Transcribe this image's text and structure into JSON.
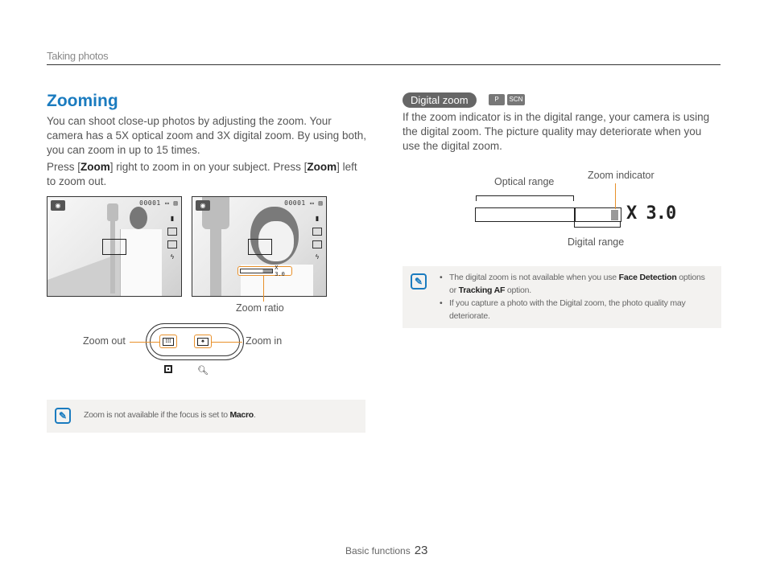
{
  "header": {
    "section": "Taking photos"
  },
  "left": {
    "title": "Zooming",
    "intro": "You can shoot close-up photos by adjusting the zoom. Your camera has a 5X optical zoom and 3X digital zoom. By using both, you can zoom in up to 15 times.",
    "press": {
      "pre": "Press [",
      "key1": "Zoom",
      "mid": "] right to zoom in on your subject. Press [",
      "key2": "Zoom",
      "post": "] left to zoom out."
    },
    "screen": {
      "mode_icon": "camera-program-icon",
      "status": "00001 ▭ ▥",
      "side_icons": [
        "image-size-icon",
        "quality-icon",
        "metering-icon",
        "flash-auto-icon"
      ],
      "zoom_bar_text": "X 3.0"
    },
    "zoom_ratio_label": "Zoom ratio",
    "lever": {
      "zoom_out_label": "Zoom out",
      "zoom_in_label": "Zoom in",
      "out_icon": "wide-icon",
      "in_icon": "tele-icon"
    },
    "note": {
      "icon": "note-pencil-icon",
      "text_pre": "Zoom is not available if the focus is set to ",
      "bold": "Macro",
      "text_post": "."
    }
  },
  "right": {
    "badge": "Digital zoom",
    "mode_icons": [
      "program-mode-icon",
      "scene-mode-icon"
    ],
    "mode_icon_text": [
      "P",
      "SCN"
    ],
    "para": "If the zoom indicator is in the digital range, your camera is using the digital zoom. The picture quality may deteriorate when you use the digital zoom.",
    "diagram": {
      "optical_label": "Optical range",
      "indicator_label": "Zoom indicator",
      "digital_label": "Digital range",
      "zoom_value": "X 3.0"
    },
    "note": {
      "icon": "note-pencil-icon",
      "items": [
        {
          "pre": "The digital zoom is not available when you use ",
          "b1": "Face Detection",
          "mid": " options or ",
          "b2": "Tracking AF",
          "post": " option."
        },
        {
          "text": "If you capture a photo with the Digital zoom, the photo quality may deteriorate."
        }
      ]
    }
  },
  "footer": {
    "label": "Basic functions",
    "page": "23"
  },
  "colors": {
    "title": "#1a7bbf",
    "accent": "#e8902a",
    "note_bg": "#f3f2f0",
    "badge_bg": "#666666"
  }
}
